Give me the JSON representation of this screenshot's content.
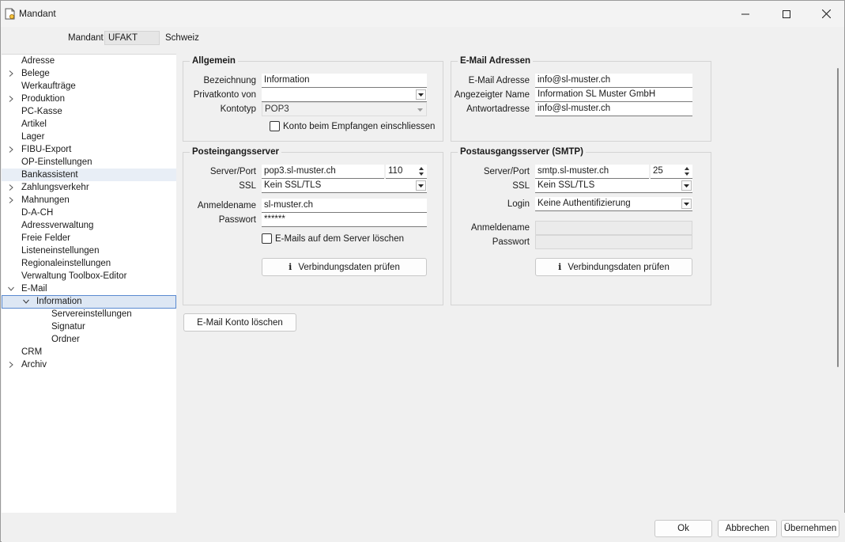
{
  "window": {
    "title": "Mandant"
  },
  "mandant": {
    "label": "Mandant",
    "code": "UFAKT",
    "name": "Schweiz"
  },
  "tree": {
    "items": [
      {
        "label": "Adresse"
      },
      {
        "label": "Belege"
      },
      {
        "label": "Werkaufträge"
      },
      {
        "label": "Produktion"
      },
      {
        "label": "PC-Kasse"
      },
      {
        "label": "Artikel"
      },
      {
        "label": "Lager"
      },
      {
        "label": "FIBU-Export"
      },
      {
        "label": "OP-Einstellungen"
      },
      {
        "label": "Bankassistent"
      },
      {
        "label": "Zahlungsverkehr"
      },
      {
        "label": "Mahnungen"
      },
      {
        "label": "D-A-CH"
      },
      {
        "label": "Adressverwaltung"
      },
      {
        "label": "Freie Felder"
      },
      {
        "label": "Listeneinstellungen"
      },
      {
        "label": "Regionaleinstellungen"
      },
      {
        "label": "Verwaltung Toolbox-Editor"
      },
      {
        "label": "E-Mail"
      },
      {
        "label": "Information"
      },
      {
        "label": "Servereinstellungen"
      },
      {
        "label": "Signatur"
      },
      {
        "label": "Ordner"
      },
      {
        "label": "CRM"
      },
      {
        "label": "Archiv"
      }
    ]
  },
  "allgemein": {
    "title": "Allgemein",
    "bezeichnung_label": "Bezeichnung",
    "bezeichnung_value": "Information",
    "privatkonto_label": "Privatkonto von",
    "privatkonto_value": "",
    "kontotyp_label": "Kontotyp",
    "kontotyp_value": "POP3",
    "konto_check_label": "Konto beim Empfangen einschliessen"
  },
  "email_adressen": {
    "title": "E-Mail Adressen",
    "email_label": "E-Mail Adresse",
    "email_value": "info@sl-muster.ch",
    "name_label": "Angezeigter Name",
    "name_value": "Information SL Muster GmbH",
    "antwort_label": "Antwortadresse",
    "antwort_value": "info@sl-muster.ch"
  },
  "posteingang": {
    "title": "Posteingangsserver",
    "server_label": "Server/Port",
    "server_value": "pop3.sl-muster.ch",
    "port_value": "110",
    "ssl_label": "SSL",
    "ssl_value": "Kein SSL/TLS",
    "anmeldename_label": "Anmeldename",
    "anmeldename_value": "sl-muster.ch",
    "passwort_label": "Passwort",
    "passwort_value": "******",
    "delete_check_label": "E-Mails auf dem Server löschen",
    "verify_button": "Verbindungsdaten prüfen"
  },
  "postausgang": {
    "title": "Postausgangsserver (SMTP)",
    "server_label": "Server/Port",
    "server_value": "smtp.sl-muster.ch",
    "port_value": "25",
    "ssl_label": "SSL",
    "ssl_value": "Kein SSL/TLS",
    "login_label": "Login",
    "login_value": "Keine Authentifizierung",
    "anmeldename_label": "Anmeldename",
    "passwort_label": "Passwort",
    "verify_button": "Verbindungsdaten prüfen"
  },
  "delete_account_button": "E-Mail Konto löschen",
  "footer": {
    "ok": "Ok",
    "cancel": "Abbrechen",
    "apply": "Übernehmen"
  },
  "colors": {
    "selection_border": "#5a8ad0",
    "selection_bg": "#dde7f4",
    "highlight_bg": "#e8eef6"
  }
}
